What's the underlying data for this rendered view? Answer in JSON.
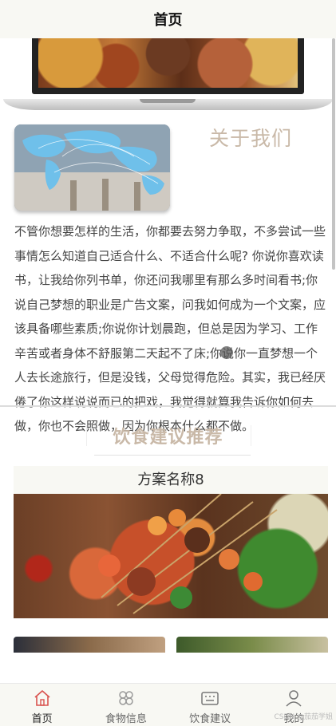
{
  "nav": {
    "title": "首页"
  },
  "about": {
    "heading": "关于我们",
    "text": "不管你想要怎样的生活，你都要去努力争取，不多尝试一些事情怎么知道自己适合什么、不适合什么呢? 你说你喜欢读书，让我给你列书单，你还问我哪里有那么多时间看书;你说自己梦想的职业是广告文案，问我如何成为一个文案，应该具备哪些素质;你说你计划晨跑，但总是因为学习、工作辛苦或者身体不舒服第二天起不了床;你说你一直梦想一个人去长途旅行，但是没钱，父母觉得危险。其实，我已经厌倦了你这样说说而已的把戏，我觉得就算我告诉你如何去做，你也不会照做，因为你根本什么都不做。"
  },
  "recommend": {
    "heading": "饮食建议推荐",
    "plan_name": "方案名称8"
  },
  "tabs": [
    {
      "label": "首页",
      "icon": "home-icon",
      "active": true
    },
    {
      "label": "食物信息",
      "icon": "clover-icon",
      "active": false
    },
    {
      "label": "饮食建议",
      "icon": "keyboard-icon",
      "active": false
    },
    {
      "label": "我的",
      "icon": "user-icon",
      "active": false
    }
  ],
  "watermark": "CSDN @茄茄学姐",
  "colors": {
    "active_tab": "#d9534f",
    "heading_beige": "#c9b9a8",
    "bar_bg": "#f8f8f3"
  }
}
